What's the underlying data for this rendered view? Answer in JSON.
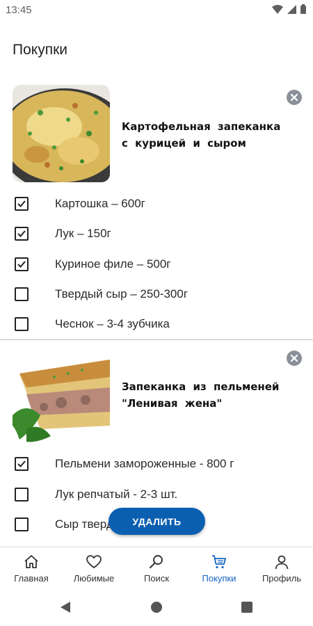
{
  "status_bar": {
    "time": "13:45"
  },
  "page": {
    "title": "Покупки"
  },
  "recipes": [
    {
      "title": "Картофельная запеканка с курицей и сыром",
      "thumbnail": "potato-casserole-photo",
      "ingredients": [
        {
          "label": "Картошка – 600г",
          "checked": true
        },
        {
          "label": "Лук – 150г",
          "checked": true
        },
        {
          "label": "Куриное филе – 500г",
          "checked": true
        },
        {
          "label": "Твердый сыр – 250-300г",
          "checked": false
        },
        {
          "label": "Чеснок – 3-4 зубчика",
          "checked": false
        }
      ]
    },
    {
      "title": "Запеканка из пельменей \"Ленивая жена\"",
      "thumbnail": "dumpling-casserole-photo",
      "ingredients": [
        {
          "label": "Пельмени замороженные - 800 г",
          "checked": true
        },
        {
          "label": "Лук репчатый - 2-3 шт.",
          "checked": false
        },
        {
          "label": "Сыр твердый",
          "checked": false
        }
      ]
    }
  ],
  "actions": {
    "delete_label": "УДАЛИТЬ"
  },
  "bottom_nav": [
    {
      "label": "Главная",
      "icon": "home-icon",
      "active": false
    },
    {
      "label": "Любимые",
      "icon": "heart-icon",
      "active": false
    },
    {
      "label": "Поиск",
      "icon": "search-icon",
      "active": false
    },
    {
      "label": "Покупки",
      "icon": "cart-icon",
      "active": true
    },
    {
      "label": "Профиль",
      "icon": "person-icon",
      "active": false
    }
  ],
  "colors": {
    "accent": "#0b5fb0",
    "active_nav": "#1565c0",
    "remove_icon": "#8a9099"
  }
}
